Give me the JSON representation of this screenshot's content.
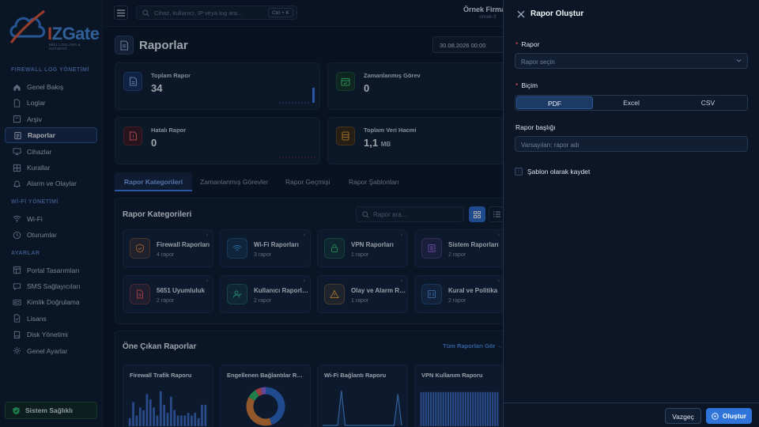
{
  "sidebar": {
    "logo_text_a": "I",
    "logo_text_b": "ZGate",
    "logo_tagline": "5651 LOGLAMA & HOTSPOT",
    "sections": [
      {
        "title": "FIREWALL LOG YÖNETİMİ",
        "items": [
          {
            "label": "Genel Bakış",
            "icon": "home-icon"
          },
          {
            "label": "Loglar",
            "icon": "file-icon"
          },
          {
            "label": "Arşiv",
            "icon": "archive-icon"
          },
          {
            "label": "Raporlar",
            "icon": "report-icon",
            "active": true
          },
          {
            "label": "Cihazlar",
            "icon": "monitor-icon"
          },
          {
            "label": "Kurallar",
            "icon": "grid-icon"
          },
          {
            "label": "Alarm ve Olaylar",
            "icon": "bell-icon"
          }
        ]
      },
      {
        "title": "Wİ-Fİ YÖNETİMİ",
        "items": [
          {
            "label": "Wi-Fi",
            "icon": "wifi-icon"
          },
          {
            "label": "Oturumlar",
            "icon": "clock-icon"
          }
        ]
      },
      {
        "title": "AYARLAR",
        "items": [
          {
            "label": "Portal Tasarımları",
            "icon": "layout-icon"
          },
          {
            "label": "SMS Sağlayıcıları",
            "icon": "message-icon"
          },
          {
            "label": "Kimlik Doğrulama",
            "icon": "id-card-icon"
          },
          {
            "label": "Lisans",
            "icon": "license-icon"
          },
          {
            "label": "Disk Yönetimi",
            "icon": "disk-icon"
          },
          {
            "label": "Genel Ayarlar",
            "icon": "gear-icon"
          }
        ]
      }
    ],
    "health_label": "Sistem Sağlıklı"
  },
  "topbar": {
    "search_placeholder": "Cihaz, kullanıcı, IP veya log ara...",
    "search_shortcut": "Ctrl + K",
    "company": "Örnek Firma A",
    "company_sub": "ornek-fi"
  },
  "main": {
    "title": "Raporlar",
    "date_value": "30.08.2026 00:00",
    "stats": [
      {
        "label": "Toplam Rapor",
        "value": "34",
        "unit": ""
      },
      {
        "label": "Zamanlanmış Görev",
        "value": "0",
        "unit": ""
      },
      {
        "label": "Hatalı Rapor",
        "value": "0",
        "unit": ""
      },
      {
        "label": "Toplam Veri Hacmi",
        "value": "1,1",
        "unit": "MB"
      }
    ],
    "tabs": [
      "Rapor Kategorileri",
      "Zamanlanmış Görevler",
      "Rapor Geçmişi",
      "Rapor Şablonları"
    ],
    "categories_title": "Rapor Kategorileri",
    "categories_search_placeholder": "Rapor ara...",
    "categories": [
      {
        "name": "Firewall Raporları",
        "count": "4 rapor",
        "color": "#e0823a"
      },
      {
        "name": "Wi-Fi Raporları",
        "count": "3 rapor",
        "color": "#3aa0e8"
      },
      {
        "name": "VPN Raporları",
        "count": "1 rapor",
        "color": "#2fbf6a"
      },
      {
        "name": "Sistem Raporları",
        "count": "2 rapor",
        "color": "#9a6ae8"
      },
      {
        "name": "5651 Uyumluluk",
        "count": "2 rapor",
        "color": "#e85a5a"
      },
      {
        "name": "Kullanıcı Raporları",
        "count": "2 rapor",
        "color": "#2fbfa0"
      },
      {
        "name": "Olay ve Alarm Raporları",
        "count": "1 rapor",
        "color": "#e8a03a"
      },
      {
        "name": "Kural ve Politika",
        "count": "2 rapor",
        "color": "#4a8fe0"
      }
    ],
    "featured_title": "Öne Çıkan Raporlar",
    "featured_see_all": "Tüm Raporları Gör",
    "featured": [
      {
        "title": "Firewall Trafik Raporu"
      },
      {
        "title": "Engellenen Bağlantılar Raporu"
      },
      {
        "title": "Wi-Fi Bağlantı Raporu"
      },
      {
        "title": "VPN Kullanım Raporu"
      }
    ]
  },
  "drawer": {
    "title": "Rapor Oluştur",
    "report_label": "Rapor",
    "report_placeholder": "Rapor seçin",
    "format_label": "Biçim",
    "formats": [
      "PDF",
      "Excel",
      "CSV"
    ],
    "selected_format": "PDF",
    "report_title_label": "Rapor başlığı",
    "report_title_placeholder": "Varsayılan: rapor adı",
    "save_template_label": "Şablon olarak kaydet",
    "cancel_label": "Vazgeç",
    "create_label": "Oluştur"
  },
  "chart_data": [
    {
      "type": "bar",
      "title": "Firewall Trafik Raporu",
      "values": [
        3,
        9,
        4,
        7,
        6,
        12,
        10,
        7,
        4,
        13,
        8,
        5,
        11,
        6,
        4,
        4,
        4,
        5,
        4,
        5,
        3,
        8,
        8
      ]
    },
    {
      "type": "pie",
      "title": "Engellenen Bağlantılar Raporu",
      "values": [
        45,
        38,
        8,
        5,
        4
      ],
      "colors": [
        "#2f6fd0",
        "#e0823a",
        "#2fbf6a",
        "#e85a5a",
        "#9a6ae8"
      ]
    },
    {
      "type": "line",
      "title": "Wi-Fi Bağlantı Raporu",
      "values": [
        0,
        0,
        0,
        0,
        0,
        10,
        0,
        0,
        0,
        0,
        0,
        0,
        0,
        0,
        0,
        0,
        0,
        0,
        0,
        0,
        9,
        0
      ]
    },
    {
      "type": "bar",
      "title": "VPN Kullanım Raporu",
      "values": [
        9,
        9,
        9,
        9,
        9,
        9,
        9,
        9,
        9,
        9,
        9,
        9,
        9,
        9,
        9,
        9,
        9,
        9,
        9,
        9,
        9,
        9,
        9,
        9,
        9,
        9,
        9,
        9,
        9,
        9,
        9,
        9
      ]
    }
  ]
}
